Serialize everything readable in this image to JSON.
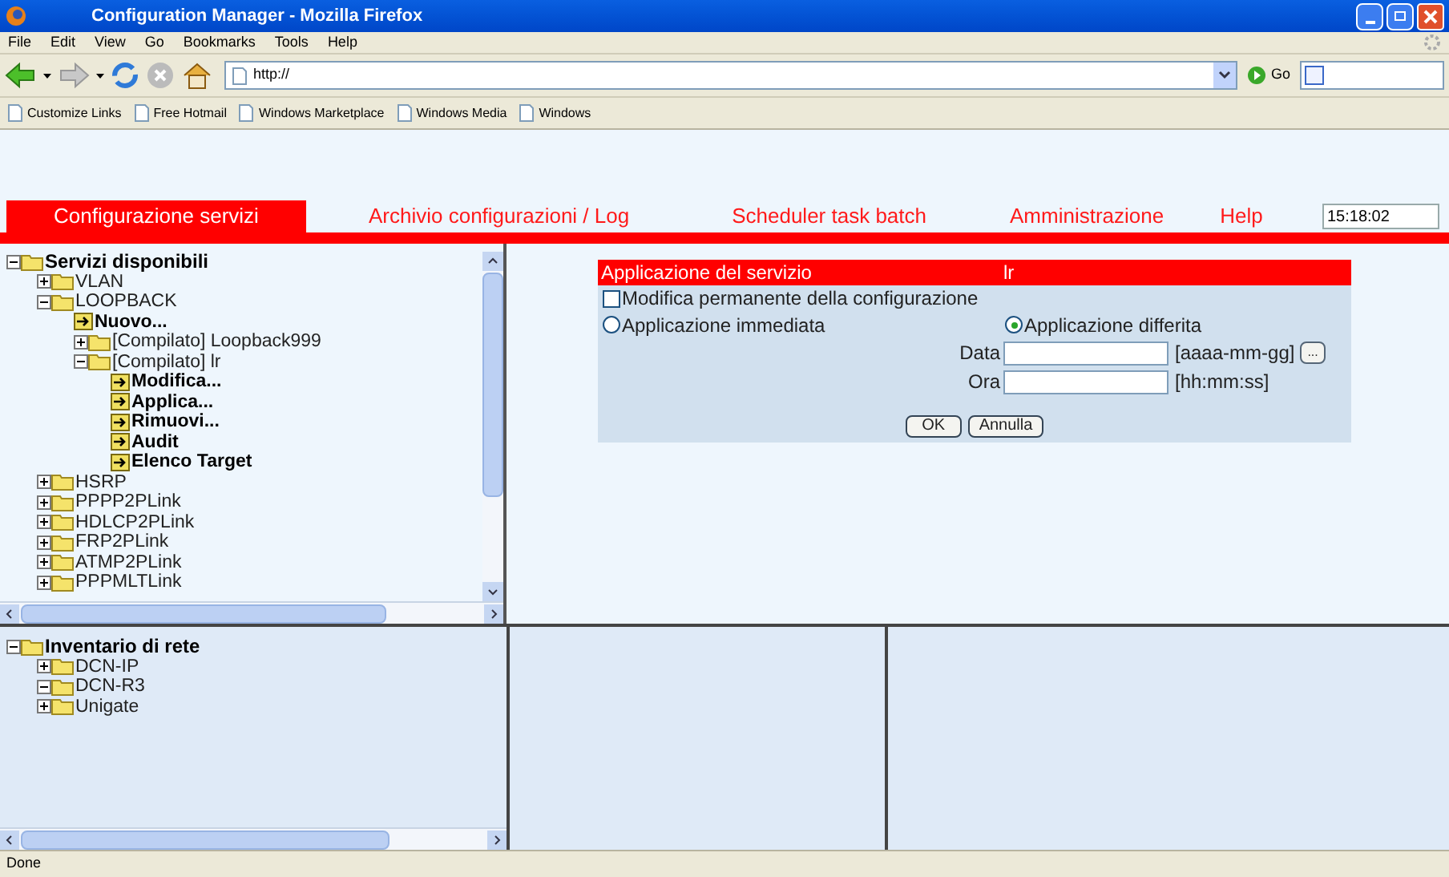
{
  "window": {
    "title": "Configuration Manager - Mozilla Firefox"
  },
  "menu": [
    "File",
    "Edit",
    "View",
    "Go",
    "Bookmarks",
    "Tools",
    "Help"
  ],
  "address": {
    "value": "http://",
    "go_label": "Go"
  },
  "bookmarks": [
    "Customize Links",
    "Free Hotmail",
    "Windows Marketplace",
    "Windows Media",
    "Windows"
  ],
  "tabs": [
    {
      "label": "Configurazione servizi",
      "selected": true
    },
    {
      "label": "Archivio configurazioni / Log",
      "selected": false
    },
    {
      "label": "Scheduler task batch",
      "selected": false
    },
    {
      "label": "Amministrazione",
      "selected": false
    },
    {
      "label": "Help",
      "selected": false
    }
  ],
  "clock": "15:18:02",
  "services_tree": {
    "label": "Servizi disponibili",
    "kind": "folder",
    "expanded": true,
    "children": [
      {
        "label": "VLAN",
        "kind": "folder",
        "expanded": false
      },
      {
        "label": "LOOPBACK",
        "kind": "folder",
        "expanded": true,
        "children": [
          {
            "label": "Nuovo...",
            "kind": "action"
          },
          {
            "label": "[Compilato] Loopback999",
            "kind": "folder",
            "expanded": false
          },
          {
            "label": "[Compilato] lr",
            "kind": "folder",
            "expanded": true,
            "children": [
              {
                "label": "Modifica...",
                "kind": "action"
              },
              {
                "label": "Applica...",
                "kind": "action"
              },
              {
                "label": "Rimuovi...",
                "kind": "action"
              },
              {
                "label": "Audit",
                "kind": "action"
              },
              {
                "label": "Elenco Target",
                "kind": "action"
              }
            ]
          }
        ]
      },
      {
        "label": "HSRP",
        "kind": "folder",
        "expanded": false
      },
      {
        "label": "PPPP2PLink",
        "kind": "folder",
        "expanded": false
      },
      {
        "label": "HDLCP2PLink",
        "kind": "folder",
        "expanded": false
      },
      {
        "label": "FRP2PLink",
        "kind": "folder",
        "expanded": false
      },
      {
        "label": "ATMP2PLink",
        "kind": "folder",
        "expanded": false
      },
      {
        "label": "PPPMLTLink",
        "kind": "folder",
        "expanded": false
      }
    ]
  },
  "form": {
    "title": "Applicazione del servizio",
    "service": "lr",
    "permanent": {
      "label": "Modifica permanente della configurazione",
      "checked": false
    },
    "modes": [
      {
        "label": "Applicazione immediata",
        "selected": false
      },
      {
        "label": "Applicazione differita",
        "selected": true
      }
    ],
    "date": {
      "label": "Data",
      "format": "[aaaa-mm-gg]",
      "picker": "..."
    },
    "time": {
      "label": "Ora",
      "format": "[hh:mm:ss]"
    },
    "buttons": [
      "OK",
      "Annulla"
    ]
  },
  "inventory_tree": {
    "label": "Inventario di rete",
    "kind": "folder",
    "expanded": true,
    "children": [
      {
        "label": "DCN-IP",
        "kind": "folder",
        "expanded": false
      },
      {
        "label": "DCN-R3",
        "kind": "folder",
        "expanded": true
      },
      {
        "label": "Unigate",
        "kind": "folder",
        "expanded": false
      }
    ]
  },
  "status_bar": "Done"
}
